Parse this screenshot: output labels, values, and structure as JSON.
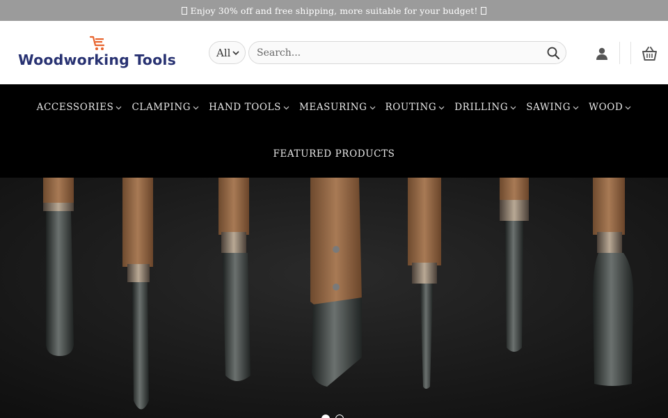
{
  "announcement": {
    "text": "Enjoy 30% off and free shipping, more suitable for your budget!"
  },
  "header": {
    "logo_text": "Woodworking Tools",
    "category_select": {
      "value": "All"
    },
    "search": {
      "placeholder": "Search..."
    },
    "icons": [
      "search-icon",
      "user-icon",
      "basket-icon",
      "chevron-down-icon"
    ]
  },
  "nav": {
    "items": [
      {
        "label": "ACCESSORIES"
      },
      {
        "label": "CLAMPING"
      },
      {
        "label": "HAND TOOLS"
      },
      {
        "label": "MEASURING"
      },
      {
        "label": "ROUTING"
      },
      {
        "label": "DRILLING"
      },
      {
        "label": "SAWING"
      },
      {
        "label": "WOOD"
      }
    ],
    "featured": {
      "label": "FEATURED PRODUCTS"
    }
  },
  "hero": {
    "slide_count": 2,
    "active_slide": 1
  },
  "colors": {
    "topbar_bg": "#9b9b9b",
    "logo_text": "#283272",
    "logo_accent": "#e8622b",
    "nav_bg": "#000000"
  }
}
